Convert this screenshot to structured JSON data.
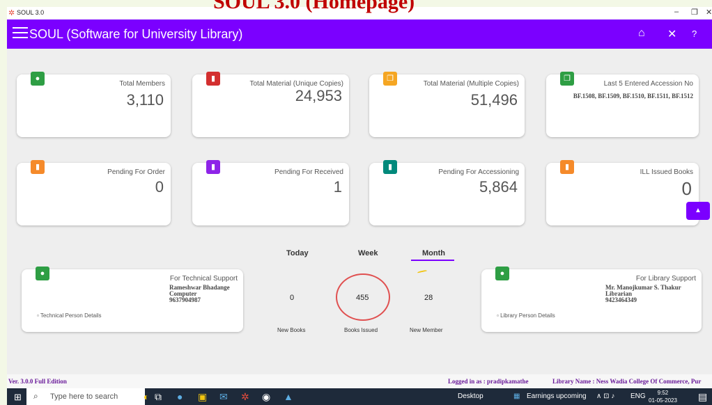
{
  "overlay_title": "SOUL 3.0 (Homepage)",
  "window": {
    "title": "SOUL 3.0",
    "minimize": "–",
    "maximize": "❐",
    "close": "✕"
  },
  "appbar": {
    "title": "SOUL (Software for University Library)",
    "home_icon": "home-icon",
    "close_icon": "close-icon",
    "help_icon": "help-icon"
  },
  "cards": [
    {
      "label": "Total Members",
      "value": "3,110",
      "color": "#2e9e44",
      "icon": "person-icon"
    },
    {
      "label": "Total Material (Unique Copies)",
      "value": "24,953",
      "color": "#d32f2f",
      "icon": "document-icon"
    },
    {
      "label": "Total Material (Multiple Copies)",
      "value": "51,496",
      "color": "#f5a623",
      "icon": "copy-icon"
    },
    {
      "label": "Last 5 Entered Accession No",
      "value": "BF.1508, BF.1509, BF.1510, BF.1511, BF.1512",
      "color": "#2e9e44",
      "icon": "copy-icon"
    },
    {
      "label": "Pending For Order",
      "value": "0",
      "color": "#f58a2a",
      "icon": "bookmark-icon"
    },
    {
      "label": "Pending For Received",
      "value": "1",
      "color": "#8e24e8",
      "icon": "bookmark-icon"
    },
    {
      "label": "Pending For Accessioning",
      "value": "5,864",
      "color": "#00897b",
      "icon": "bookmark-icon"
    },
    {
      "label": "ILL Issued Books",
      "value": "0",
      "color": "#f58a2a",
      "icon": "bookmark-icon"
    }
  ],
  "tabs": [
    "Today",
    "Week",
    "Month"
  ],
  "active_tab": "Month",
  "stats": [
    {
      "value": "0",
      "label": "New Books"
    },
    {
      "value": "455",
      "label": "Books Issued"
    },
    {
      "value": "28",
      "label": "New Member"
    }
  ],
  "tech_support": {
    "title": "For Technical Support",
    "name": "Rameshwar Bhadange",
    "role": "Computer",
    "phone": "9637904987",
    "link": "Technical Person Details"
  },
  "library_support": {
    "title": "For Library Support",
    "name": "Mr. Manojkumar S. Thakur",
    "role": "Librarian",
    "phone": "9423464349",
    "link": "Library Person Details"
  },
  "status": {
    "version": "Ver. 3.0.0  Full Edition",
    "logged_in": "Logged in as : pradipkamathe",
    "library": "Library Name : Ness Wadia College Of Commerce, Pur"
  },
  "taskbar": {
    "search_placeholder": "Type here to search",
    "desktop": "Desktop",
    "news": "Earnings upcoming",
    "lang": "ENG",
    "time": "9:52",
    "date": "01-05-2023"
  }
}
